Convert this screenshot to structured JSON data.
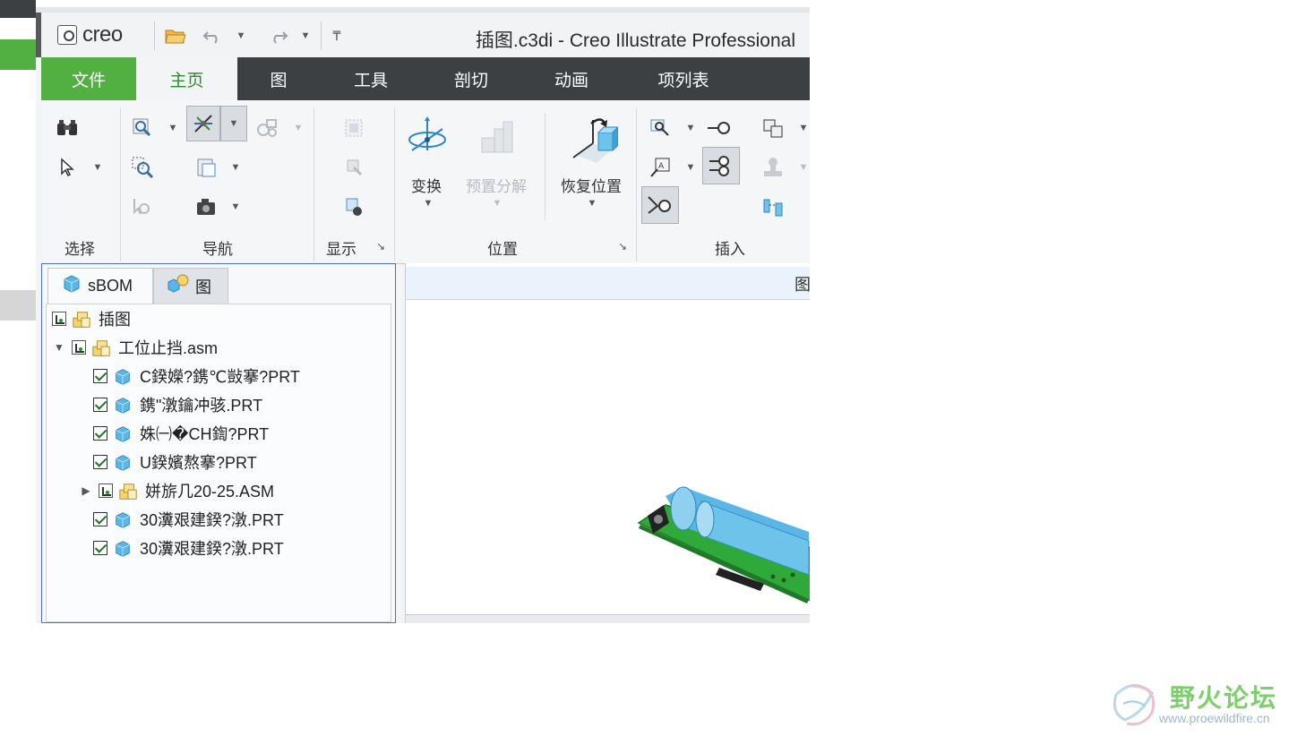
{
  "window": {
    "title": "插图.c3di - Creo Illustrate Professional",
    "logo_text": "creo"
  },
  "quick_access": [
    {
      "name": "open-folder-icon"
    },
    {
      "name": "undo-icon"
    },
    {
      "name": "undo-dropdown-icon"
    },
    {
      "name": "redo-icon"
    },
    {
      "name": "redo-dropdown-icon"
    },
    {
      "name": "customize-toolbar-icon"
    }
  ],
  "ribbon_tabs": [
    "文件",
    "主页",
    "图",
    "工具",
    "剖切",
    "动画",
    "项列表"
  ],
  "ribbon_active_tab": "主页",
  "ribbon_groups": {
    "select": "选择",
    "navigate": "导航",
    "display": "显示",
    "position": "位置",
    "insert": "插入"
  },
  "ribbon_buttons": {
    "transform": "变换",
    "preset_explode": "预置分解",
    "restore_position": "恢复位置"
  },
  "tree_tabs": [
    "sBOM",
    "图"
  ],
  "tree_items": [
    {
      "label": "插图",
      "level": 0,
      "expander": "",
      "check": "partial",
      "icon": "assembly"
    },
    {
      "label": "工位止挡.asm",
      "level": 0,
      "expander": "▼",
      "check": "partial",
      "icon": "assembly"
    },
    {
      "label": "C鍨嬫?鎸℃敱搴?PRT",
      "level": 1,
      "expander": "",
      "check": "checked",
      "icon": "part"
    },
    {
      "label": "鎸\"潡鑰冲骇.PRT",
      "level": 1,
      "expander": "",
      "check": "checked",
      "icon": "part"
    },
    {
      "label": "姝㈠�CH鍧?PRT",
      "level": 1,
      "expander": "",
      "check": "checked",
      "icon": "part"
    },
    {
      "label": "U鍨嬪熬搴?PRT",
      "level": 1,
      "expander": "",
      "check": "checked",
      "icon": "part"
    },
    {
      "label": "姘旂几20-25.ASM",
      "level": 1,
      "expander": "▶",
      "check": "partial",
      "icon": "assembly"
    },
    {
      "label": "30瀵艰建鍨?潡.PRT",
      "level": 1,
      "expander": "",
      "check": "checked",
      "icon": "part"
    },
    {
      "label": "30瀵艰建鍨?潡.PRT",
      "level": 1,
      "expander": "",
      "check": "checked",
      "icon": "part"
    }
  ],
  "viewport": {
    "header_text": "图"
  },
  "watermark": {
    "text": "野火论坛",
    "url": "www.proewildfire.cn"
  },
  "colors": {
    "accent_green": "#52b043",
    "ribbon_dark": "#3d4043",
    "panel_border": "#4f6fb8",
    "part_blue": "#5bb6e6",
    "plate_green": "#2faa3a"
  }
}
